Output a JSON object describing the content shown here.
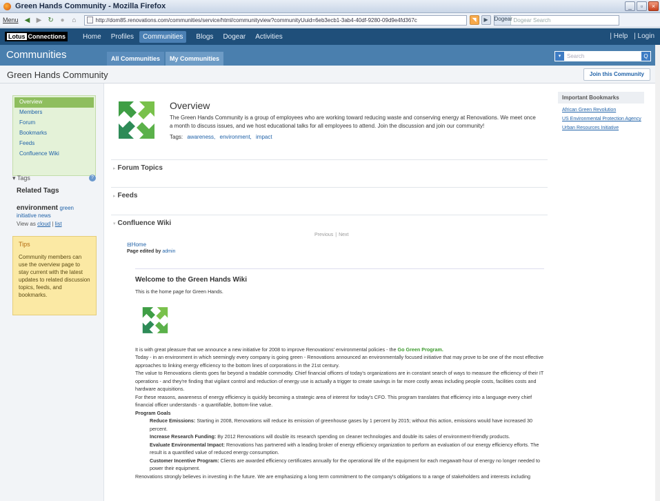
{
  "window": {
    "title": "Green Hands Community - Mozilla Firefox",
    "buttons": [
      "_",
      "▫",
      "×"
    ]
  },
  "browser": {
    "menu": "Menu",
    "url": "http://dom85.renovations.com/communities/service/html/communityview?communityUuid=6eb3ecb1-3ab4-40df-9280-09d9e4fd367c",
    "search_engine": "Dogear",
    "search_placeholder": "Dogear Search"
  },
  "app": {
    "product_logo": "Lotus",
    "product_name": "Connections",
    "nav": [
      "Home",
      "Profiles",
      "Communities",
      "Blogs",
      "Dogear",
      "Activities"
    ],
    "active_nav": "Communities",
    "right_links": [
      "Help",
      "Login"
    ],
    "divider": "|"
  },
  "communities_bar": {
    "title": "Communities",
    "tabs": [
      "All Communities",
      "My Communities"
    ],
    "search_placeholder": "Search",
    "search_go": "Q"
  },
  "community": {
    "name": "Green Hands Community",
    "join_button": "Join this Community"
  },
  "left_nav": {
    "items": [
      "Overview",
      "Members",
      "Forum",
      "Bookmarks",
      "Feeds",
      "Confluence Wiki"
    ],
    "selected": "Overview"
  },
  "tags_panel": {
    "header": "Tags",
    "help": "?",
    "collapse_icon": "▾",
    "related": "Related Tags",
    "tags": [
      {
        "text": "environment"
      },
      {
        "text": "green"
      },
      {
        "text": "initiative news"
      }
    ],
    "view_as_label": "View as",
    "views": [
      "cloud",
      "list"
    ]
  },
  "tips": {
    "title": "Tips",
    "text": "Community members can use the overview page to stay current with the latest updates to related discussion topics, feeds, and bookmarks."
  },
  "overview": {
    "title": "Overview",
    "description": "The Green Hands Community is a group of employees who are working toward reducing waste and conserving energy at Renovations. We meet once a month to discuss issues, and we host educational talks for all employees to attend. Join the discussion and join our community!",
    "tags_label": "Tags:",
    "tags": [
      "awareness,",
      "environment,",
      "impact"
    ]
  },
  "sections": [
    "Forum Topics",
    "Feeds",
    "Confluence Wiki"
  ],
  "wiki": {
    "pager": [
      "Previous",
      "Next"
    ],
    "home": "Home",
    "edited_label": "Page edited by",
    "edited_by": "admin",
    "heading": "Welcome to the Green Hands Wiki",
    "intro": "This is the home page for Green Hands.",
    "p1a": "It is with great pleasure that we announce a new initiative for 2008 to improve Renovations' environmental policies - the",
    "p1b": "Go Green Program.",
    "p2": "Today - in an environment in which seemingly every company is going green - Renovations announced an environmentally focused initiative that may prove to be one of the most effective approaches to linking energy efficiency to the bottom lines of corporations in the 21st century.",
    "p3": "The value to Renovations clients goes far beyond a tradable commodity. Chief financial officers of today's organizations are in constant search of ways to measure the efficiency of their IT operations - and they're finding that vigilant control and reduction of energy use is actually a trigger to create savings in far more costly areas including people costs, facilities costs and hardware acquisitions.",
    "p4": "For these reasons, awareness of energy efficiency is quickly becoming a strategic area of interest for today's CFO. This program translates that efficiency into a language every chief financial officer understands - a quantifiable, bottom-line value.",
    "goals_heading": "Program Goals",
    "goals": [
      {
        "title": "Reduce Emissions:",
        "text": "Starting in 2008, Renovations will reduce its emission of greenhouse gases by 1 percent by 2015; without this action, emissions would have increased 30 percent."
      },
      {
        "title": "Increase Research Funding:",
        "text": "By 2012 Renovations will double its research spending on cleaner technologies and double its sales of environment-friendly products."
      },
      {
        "title": "Evaluate Environmental Impact:",
        "text": "Renovations has partnered with a leading broker of energy efficiency organization to perform an evaluation of our energy efficiency efforts. The result is a quantified value of reduced energy consumption."
      },
      {
        "title": "Customer Incentive Program:",
        "text": "Clients are awarded efficiency certificates annually for the operational life of the equipment for each megawatt-hour of energy no longer needed to power their equipment."
      }
    ],
    "p5": "Renovations strongly believes in investing in the future. We are emphasizing a long term commitment to the company's obligations to a range of stakeholders and interests including"
  },
  "bookmarks": {
    "title": "Important Bookmarks",
    "items": [
      "African Green Revolution",
      "US Environmental Protection Agency",
      "Urban Resources Initiative"
    ]
  },
  "colors": {
    "app_bar": "#1f4f7a",
    "sub_bar": "#4a7fae",
    "nav_green": "#8ebe5e",
    "tips_bg": "#fbe9a4",
    "link": "#2062a8",
    "green_text": "#3e9a2f"
  },
  "icons": [
    "firefox-icon",
    "back-icon",
    "forward-icon",
    "reload-icon",
    "stop-icon",
    "home-icon",
    "page-icon",
    "rss-icon",
    "green-hands-logo-icon"
  ]
}
